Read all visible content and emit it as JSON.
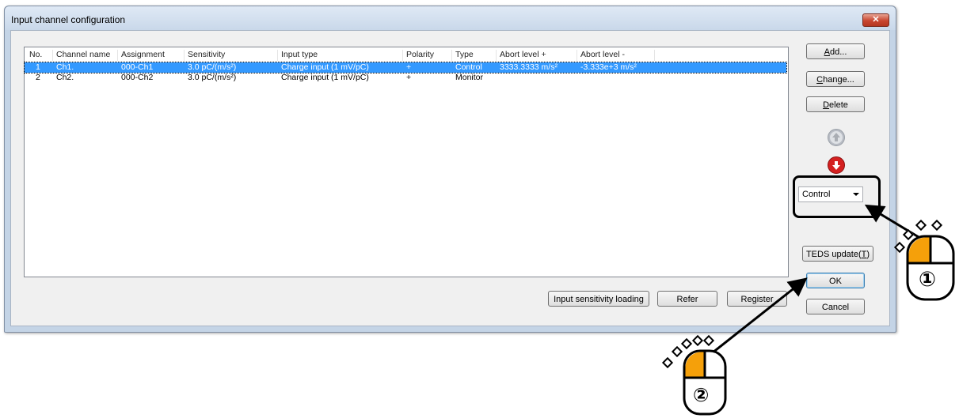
{
  "window": {
    "title": "Input channel configuration",
    "close_icon": "✕"
  },
  "table": {
    "columns": [
      "No.",
      "Channel name",
      "Assignment",
      "Sensitivity",
      "Input type",
      "Polarity",
      "Type",
      "Abort level +",
      "Abort level -"
    ],
    "rows": [
      {
        "no": "1",
        "name": "Ch1.",
        "assignment": "000-Ch1",
        "sensitivity": "3.0 pC/(m/s²)",
        "input_type": "Charge input (1 mV/pC)",
        "polarity": "+",
        "type": "Control",
        "abort_plus": "3333.3333 m/s²",
        "abort_minus": "-3.333e+3 m/s²",
        "selected": true
      },
      {
        "no": "2",
        "name": "Ch2.",
        "assignment": "000-Ch2",
        "sensitivity": "3.0 pC/(m/s²)",
        "input_type": "Charge input (1 mV/pC)",
        "polarity": "+",
        "type": "Monitor",
        "abort_plus": "",
        "abort_minus": "",
        "selected": false
      }
    ]
  },
  "buttons": {
    "add_key": "A",
    "add_rest": "dd...",
    "change_key": "C",
    "change_rest": "hange...",
    "delete_key": "D",
    "delete_rest": "elete",
    "teds_pre": "TEDS update(",
    "teds_key": "T",
    "teds_post": ")",
    "ok": "OK",
    "cancel": "Cancel",
    "input_sensitivity": "Input sensitivity loading",
    "refer": "Refer",
    "register": "Register"
  },
  "type_combo": {
    "value": "Control"
  },
  "annotations": {
    "step1": "①",
    "step2": "②"
  },
  "icons": {
    "up": "up-arrow-icon",
    "down": "down-arrow-icon"
  },
  "colors": {
    "selection": "#3399ff",
    "mouse_button": "#f5a00a",
    "down_button": "#d42020"
  }
}
